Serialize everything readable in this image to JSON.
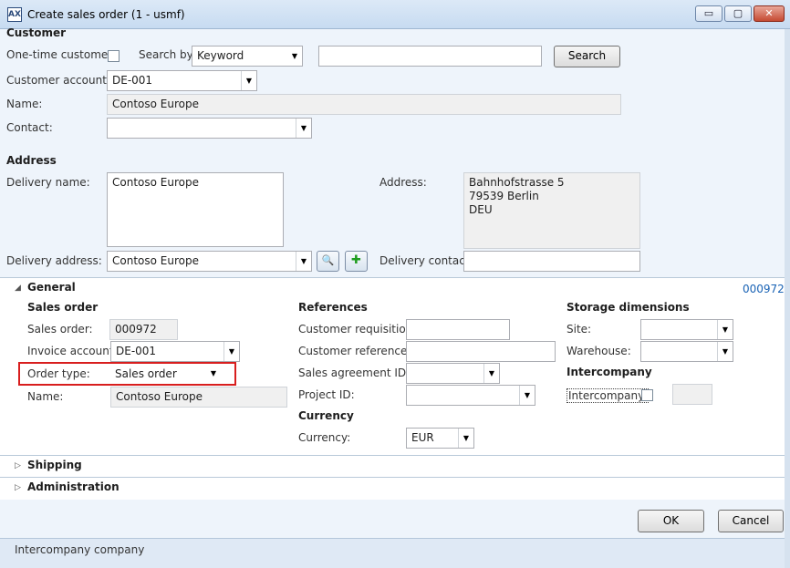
{
  "window": {
    "title": "Create sales order (1 - usmf)",
    "app_icon": "AX",
    "minimize_glyph": "▭",
    "maximize_glyph": "▢",
    "close_glyph": "✕"
  },
  "customer": {
    "header": "Customer",
    "one_time_label": "One-time customer:",
    "search_by_label": "Search by:",
    "search_by_value": "Keyword",
    "search_text": "",
    "search_button": "Search",
    "account_label": "Customer account:",
    "account_value": "DE-001",
    "name_label": "Name:",
    "name_value": "Contoso Europe",
    "contact_label": "Contact:",
    "contact_value": ""
  },
  "address": {
    "header": "Address",
    "delivery_name_label": "Delivery name:",
    "delivery_name_value": "Contoso Europe",
    "address_label": "Address:",
    "address_lines": [
      "Bahnhofstrasse 5",
      "79539 Berlin",
      "DEU"
    ],
    "delivery_address_label": "Delivery address:",
    "delivery_address_value": "Contoso Europe",
    "add_glyph": "✚",
    "lookup_glyph": "🔍",
    "delivery_contact_label": "Delivery contact:",
    "delivery_contact_value": ""
  },
  "general": {
    "tab_label": "General",
    "summary": "000972",
    "sales_order_header": "Sales order",
    "sales_order_label": "Sales order:",
    "sales_order_value": "000972",
    "invoice_account_label": "Invoice account:",
    "invoice_account_value": "DE-001",
    "order_type_label": "Order type:",
    "order_type_value": "Sales order",
    "name_label": "Name:",
    "name_value": "Contoso Europe",
    "references_header": "References",
    "customer_requisition_label": "Customer requisition:",
    "customer_requisition_value": "",
    "customer_reference_label": "Customer reference:",
    "customer_reference_value": "",
    "sales_agreement_label": "Sales agreement ID:",
    "sales_agreement_value": "",
    "project_id_label": "Project ID:",
    "project_id_value": "",
    "currency_header": "Currency",
    "currency_label": "Currency:",
    "currency_value": "EUR",
    "storage_header": "Storage dimensions",
    "site_label": "Site:",
    "site_value": "",
    "warehouse_label": "Warehouse:",
    "warehouse_value": "",
    "intercompany_header": "Intercompany",
    "intercompany_label": "Intercompany:",
    "intercompany_value": ""
  },
  "tabs": {
    "shipping": "Shipping",
    "administration": "Administration",
    "expand_glyph": "▷",
    "collapse_glyph": "◢"
  },
  "actions": {
    "ok": "OK",
    "cancel": "Cancel"
  },
  "status_bar": {
    "text": "Intercompany company"
  },
  "colors": {
    "highlight": "#d81e1e",
    "link": "#1a63b5"
  }
}
